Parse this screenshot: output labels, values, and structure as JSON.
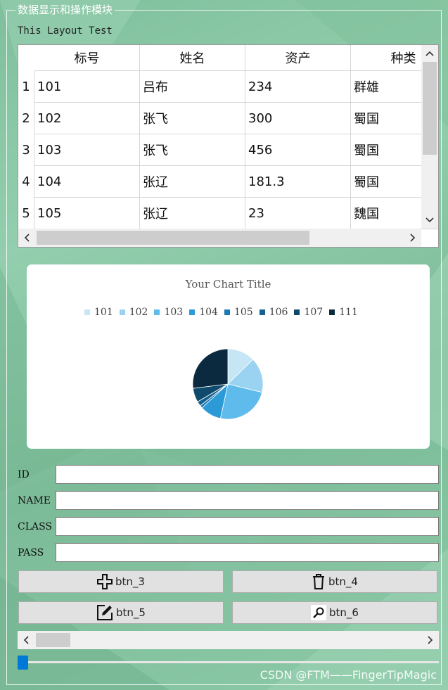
{
  "group": {
    "title": "数据显示和操作模块"
  },
  "layout_label": "This Layout Test",
  "table": {
    "columns": [
      "标号",
      "姓名",
      "资产",
      "种类"
    ],
    "row_headers": [
      "1",
      "2",
      "3",
      "4",
      "5"
    ],
    "rows": [
      [
        "101",
        "吕布",
        "234",
        "群雄"
      ],
      [
        "102",
        "张飞",
        "300",
        "蜀国"
      ],
      [
        "103",
        "张飞",
        "456",
        "蜀国"
      ],
      [
        "104",
        "张辽",
        "181.3",
        "蜀国"
      ],
      [
        "105",
        "张辽",
        "23",
        "魏国"
      ]
    ],
    "scroll_up_icon": "chevron-up-icon",
    "scroll_down_icon": "chevron-down-icon",
    "scroll_left_icon": "chevron-left-icon",
    "scroll_right_icon": "chevron-right-icon"
  },
  "chart_data": {
    "type": "pie",
    "title": "Your Chart Title",
    "legend_position": "top",
    "categories": [
      "101",
      "102",
      "103",
      "104",
      "105",
      "106",
      "107",
      "111"
    ],
    "values": [
      234,
      300,
      456,
      181.3,
      23,
      40,
      120,
      500
    ],
    "colors": [
      "#c6e6f5",
      "#9ad3f1",
      "#5fbbeb",
      "#2b9ad6",
      "#1a7ab5",
      "#15608f",
      "#0f4a6c",
      "#0b2a40"
    ]
  },
  "form": {
    "id_label": "ID",
    "name_label": "NAME",
    "class_label": "CLASS",
    "pass_label": "PASS",
    "id_value": "",
    "name_value": "",
    "class_value": "",
    "pass_value": ""
  },
  "buttons": {
    "btn_3": {
      "label": "btn_3",
      "icon": "plus-icon"
    },
    "btn_4": {
      "label": "btn_4",
      "icon": "trash-icon"
    },
    "btn_5": {
      "label": "btn_5",
      "icon": "edit-icon"
    },
    "btn_6": {
      "label": "btn_6",
      "icon": "search-icon"
    }
  },
  "slider": {
    "value_fraction": 0
  },
  "watermark": "CSDN @FTM——FingerTipMagic",
  "colors": {
    "background": "#8ccaa7",
    "slider_accent": "#0078d7"
  }
}
